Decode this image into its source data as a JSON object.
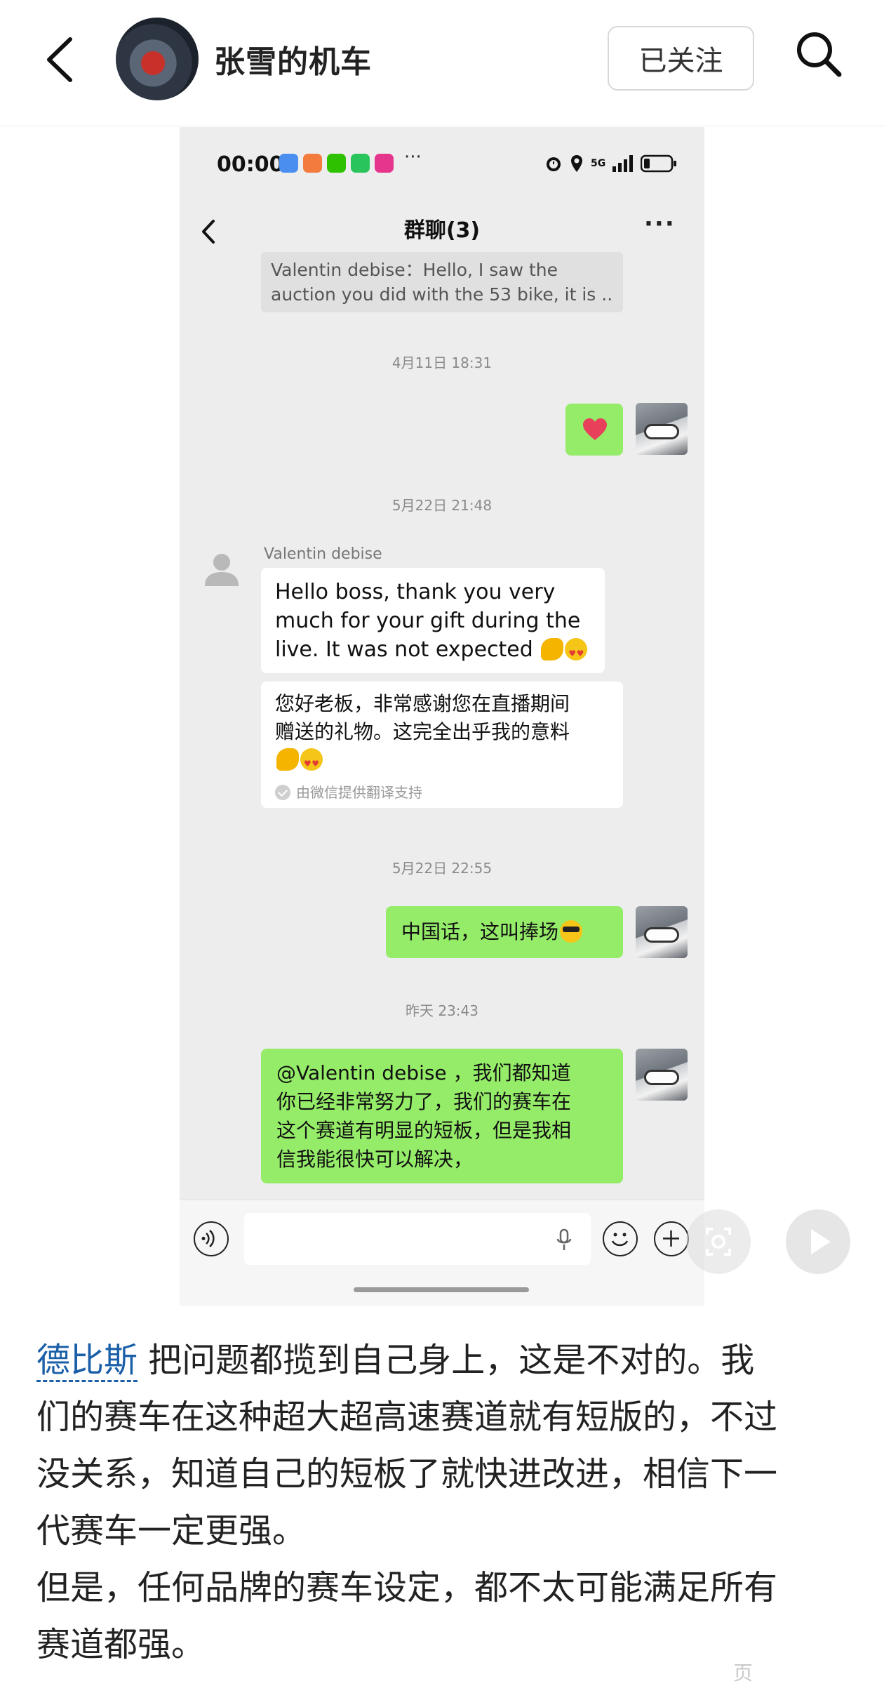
{
  "header": {
    "author_name": "张雪的机车",
    "follow_label": "已关注"
  },
  "screenshot": {
    "status_bar": {
      "time": "00:00",
      "network": "5G"
    },
    "chat": {
      "title": "群聊(3)",
      "more": "···",
      "quoted": {
        "line1": "Valentin debise：Hello, I saw the",
        "line2": "auction you did with the 53 bike, it is ..."
      },
      "timestamps": [
        "4月11日 18:31",
        "5月22日 21:48",
        "5月22日 22:55",
        "昨天 23:43"
      ],
      "sender_name": "Valentin debise",
      "msg_english": {
        "line1": "Hello boss, thank you very",
        "line2": "much for your gift during the",
        "line3": "live. It was not expected"
      },
      "msg_translation": {
        "line1": "您好老板，非常感谢您在直播期间",
        "line2": "赠送的礼物。这完全出乎我的意料",
        "note": "由微信提供翻译支持"
      },
      "msg_reply1": "中国话，这叫捧场",
      "msg_reply2": {
        "line1": "@Valentin debise ，我们都知道",
        "line2": "你已经非常努力了，我们的赛车在",
        "line3": "这个赛道有明显的短板，但是我相",
        "line4": "信我能很快可以解决，"
      }
    }
  },
  "post": {
    "mention": "德比斯",
    "line1_rest": "把问题都揽到自己身上，这是不对的。我",
    "line2": "们的赛车在这种超大超高速赛道就有短版的，不过",
    "line3": "没关系，知道自己的短板了就快进改进，相信下一",
    "line4": "代赛车一定更强。",
    "line5": "但是，任何品牌的赛车设定，都不太可能满足所有",
    "line6": "赛道都强。"
  },
  "watermark": "页"
}
